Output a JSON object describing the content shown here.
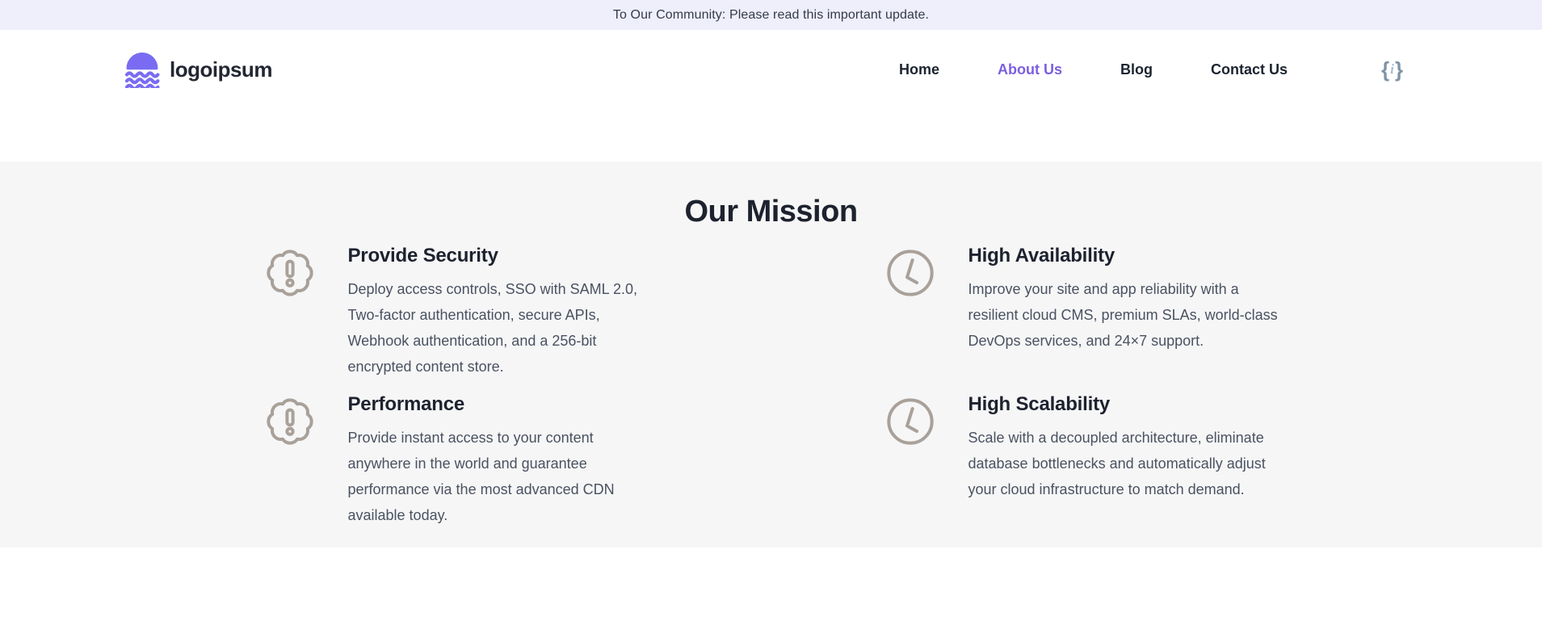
{
  "banner": {
    "text": "To Our Community: Please read this important update."
  },
  "header": {
    "logo_text": "logoipsum",
    "nav": [
      {
        "label": "Home",
        "active": false
      },
      {
        "label": "About Us",
        "active": true
      },
      {
        "label": "Blog",
        "active": false
      },
      {
        "label": "Contact Us",
        "active": false
      }
    ],
    "code_icon": {
      "open": "{",
      "letter": "i",
      "close": "}"
    }
  },
  "mission": {
    "title": "Our Mission",
    "features": [
      {
        "icon": "badge-alert-icon",
        "title": "Provide Security",
        "description": "Deploy access controls, SSO with SAML 2.0, Two-factor authentication, secure APIs, Webhook authentication, and a 256-bit encrypted content store."
      },
      {
        "icon": "clock-icon",
        "title": "High Availability",
        "description": "Improve your site and app reliability with a resilient cloud CMS, premium SLAs, world-class DevOps services, and 24×7 support."
      },
      {
        "icon": "badge-alert-icon",
        "title": "Performance",
        "description": "Provide instant access to your content anywhere in the world and guarantee performance via the most advanced CDN available today."
      },
      {
        "icon": "clock-icon",
        "title": "High Scalability",
        "description": "Scale with a decoupled architecture, eliminate database bottlenecks and automatically adjust your cloud infrastructure to match demand."
      }
    ]
  },
  "colors": {
    "banner_bg": "#efeefb",
    "accent_purple": "#7b5fe0",
    "logo_purple": "#7a6cf2",
    "section_bg": "#f6f6f7",
    "icon_stroke": "#a9a199",
    "heading": "#1d222e",
    "body_text": "#4a5260"
  }
}
